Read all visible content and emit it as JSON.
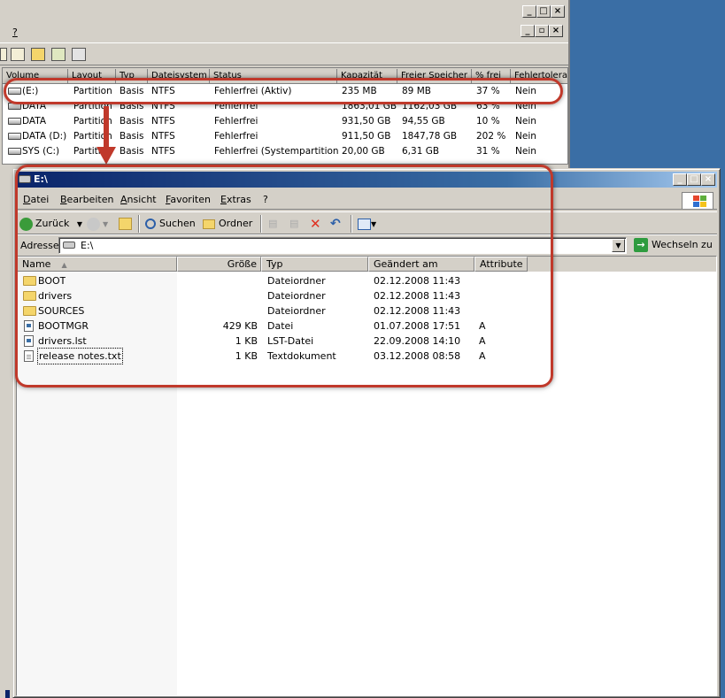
{
  "disk_management": {
    "menu": {
      "help": "?"
    },
    "columns": [
      "Volume",
      "Layout",
      "Typ",
      "Dateisystem",
      "Status",
      "Kapazität",
      "Freier Speicher",
      "% frei",
      "Fehlertolera"
    ],
    "rows": [
      {
        "volume": "(E:)",
        "layout": "Partition",
        "type": "Basis",
        "fs": "NTFS",
        "status": "Fehlerfrei (Aktiv)",
        "capacity": "235 MB",
        "free": "89 MB",
        "pct": "37 %",
        "fault": "Nein"
      },
      {
        "volume": "DATA",
        "layout": "Partition",
        "type": "Basis",
        "fs": "NTFS",
        "status": "Fehlerfrei",
        "capacity": "1863,01 GB",
        "free": "1162,03 GB",
        "pct": "63 %",
        "fault": "Nein"
      },
      {
        "volume": "DATA",
        "layout": "Partition",
        "type": "Basis",
        "fs": "NTFS",
        "status": "Fehlerfrei",
        "capacity": "931,50 GB",
        "free": "94,55 GB",
        "pct": "10 %",
        "fault": "Nein"
      },
      {
        "volume": "DATA (D:)",
        "layout": "Partition",
        "type": "Basis",
        "fs": "NTFS",
        "status": "Fehlerfrei",
        "capacity": "911,50 GB",
        "free": "1847,78 GB",
        "pct": "202 %",
        "fault": "Nein"
      },
      {
        "volume": "SYS (C:)",
        "layout": "Partition",
        "type": "Basis",
        "fs": "NTFS",
        "status": "Fehlerfrei (Systempartition)",
        "capacity": "20,00 GB",
        "free": "6,31 GB",
        "pct": "31 %",
        "fault": "Nein"
      }
    ]
  },
  "explorer": {
    "title": "E:\\",
    "menu": [
      "Datei",
      "Bearbeiten",
      "Ansicht",
      "Favoriten",
      "Extras",
      "?"
    ],
    "toolbar": {
      "back": "Zurück",
      "search": "Suchen",
      "folders": "Ordner"
    },
    "address": {
      "label": "Adresse",
      "value": "E:\\",
      "go": "Wechseln zu"
    },
    "columns": [
      "Name",
      "Größe",
      "Typ",
      "Geändert am",
      "Attribute"
    ],
    "files": [
      {
        "name": "BOOT",
        "size": "",
        "type": "Dateiordner",
        "modified": "02.12.2008 11:43",
        "attr": "",
        "icon": "folder-icon"
      },
      {
        "name": "drivers",
        "size": "",
        "type": "Dateiordner",
        "modified": "02.12.2008 11:43",
        "attr": "",
        "icon": "folder-icon"
      },
      {
        "name": "SOURCES",
        "size": "",
        "type": "Dateiordner",
        "modified": "02.12.2008 11:43",
        "attr": "",
        "icon": "folder-icon"
      },
      {
        "name": "BOOTMGR",
        "size": "429 KB",
        "type": "Datei",
        "modified": "01.07.2008 17:51",
        "attr": "A",
        "icon": "file-icon"
      },
      {
        "name": "drivers.lst",
        "size": "1 KB",
        "type": "LST-Datei",
        "modified": "22.09.2008 14:10",
        "attr": "A",
        "icon": "file-icon"
      },
      {
        "name": "release notes.txt",
        "size": "1 KB",
        "type": "Textdokument",
        "modified": "03.12.2008 08:58",
        "attr": "A",
        "icon": "text-file-icon"
      }
    ]
  },
  "colors": {
    "highlight": "#c0392b",
    "desktop": "#3a6ea5",
    "titlebar": "#0a246a"
  }
}
